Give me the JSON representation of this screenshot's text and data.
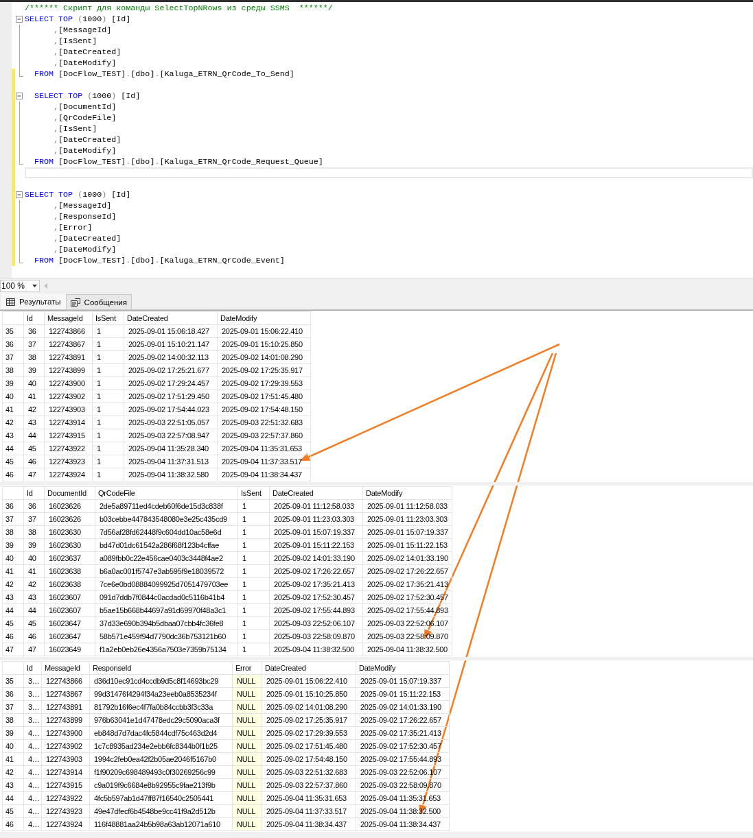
{
  "editor": {
    "lines": [
      {
        "changed": false,
        "kind": "plain",
        "current": false,
        "segments": [
          {
            "kind": "comment",
            "text": "/****** Скрипт для команды SelectTopNRows из среды SSMS  ******/"
          }
        ]
      },
      {
        "changed": false,
        "kind": "fold-start",
        "current": false,
        "segments": [
          {
            "kind": "keyword",
            "text": "SELECT TOP "
          },
          {
            "kind": "punct",
            "text": "("
          },
          {
            "kind": "plain",
            "text": "1000"
          },
          {
            "kind": "punct",
            "text": ")"
          },
          {
            "kind": "plain",
            "text": " [Id]"
          }
        ]
      },
      {
        "changed": false,
        "kind": "fold-inner",
        "current": false,
        "segments": [
          {
            "kind": "punct",
            "text": "      ,"
          },
          {
            "kind": "plain",
            "text": "[MessageId]"
          }
        ]
      },
      {
        "changed": false,
        "kind": "fold-inner",
        "current": false,
        "segments": [
          {
            "kind": "punct",
            "text": "      ,"
          },
          {
            "kind": "plain",
            "text": "[IsSent]"
          }
        ]
      },
      {
        "changed": false,
        "kind": "fold-inner",
        "current": false,
        "segments": [
          {
            "kind": "punct",
            "text": "      ,"
          },
          {
            "kind": "plain",
            "text": "[DateCreated]"
          }
        ]
      },
      {
        "changed": false,
        "kind": "fold-inner",
        "current": false,
        "segments": [
          {
            "kind": "punct",
            "text": "      ,"
          },
          {
            "kind": "plain",
            "text": "[DateModify]"
          }
        ]
      },
      {
        "changed": true,
        "kind": "fold-end",
        "current": false,
        "segments": [
          {
            "kind": "keyword",
            "text": "  FROM"
          },
          {
            "kind": "plain",
            "text": " [DocFlow_TEST]"
          },
          {
            "kind": "punct",
            "text": "."
          },
          {
            "kind": "plain",
            "text": "[dbo]"
          },
          {
            "kind": "punct",
            "text": "."
          },
          {
            "kind": "plain",
            "text": "[Kaluga_ETRN_QrCode_To_Send]"
          }
        ]
      },
      {
        "changed": true,
        "kind": "plain",
        "current": false
      },
      {
        "changed": true,
        "kind": "fold-start",
        "current": false,
        "segments": [
          {
            "kind": "keyword",
            "text": "  SELECT TOP "
          },
          {
            "kind": "punct",
            "text": "("
          },
          {
            "kind": "plain",
            "text": "1000"
          },
          {
            "kind": "punct",
            "text": ")"
          },
          {
            "kind": "plain",
            "text": " [Id]"
          }
        ]
      },
      {
        "changed": true,
        "kind": "fold-inner",
        "current": false,
        "segments": [
          {
            "kind": "punct",
            "text": "      ,"
          },
          {
            "kind": "plain",
            "text": "[DocumentId]"
          }
        ]
      },
      {
        "changed": true,
        "kind": "fold-inner",
        "current": false,
        "segments": [
          {
            "kind": "punct",
            "text": "      ,"
          },
          {
            "kind": "plain",
            "text": "[QrCodeFile]"
          }
        ]
      },
      {
        "changed": true,
        "kind": "fold-inner",
        "current": false,
        "segments": [
          {
            "kind": "punct",
            "text": "      ,"
          },
          {
            "kind": "plain",
            "text": "[IsSent]"
          }
        ]
      },
      {
        "changed": true,
        "kind": "fold-inner",
        "current": false,
        "segments": [
          {
            "kind": "punct",
            "text": "      ,"
          },
          {
            "kind": "plain",
            "text": "[DateCreated]"
          }
        ]
      },
      {
        "changed": true,
        "kind": "fold-inner",
        "current": false,
        "segments": [
          {
            "kind": "punct",
            "text": "      ,"
          },
          {
            "kind": "plain",
            "text": "[DateModify]"
          }
        ]
      },
      {
        "changed": true,
        "kind": "fold-end",
        "current": false,
        "segments": [
          {
            "kind": "keyword",
            "text": "  FROM"
          },
          {
            "kind": "plain",
            "text": " [DocFlow_TEST]"
          },
          {
            "kind": "punct",
            "text": "."
          },
          {
            "kind": "plain",
            "text": "[dbo]"
          },
          {
            "kind": "punct",
            "text": "."
          },
          {
            "kind": "plain",
            "text": "[Kaluga_ETRN_QrCode_Request_Queue]"
          }
        ]
      },
      {
        "changed": true,
        "kind": "plain",
        "current": true
      },
      {
        "changed": true,
        "kind": "plain",
        "current": false
      },
      {
        "changed": true,
        "kind": "fold-start",
        "current": false,
        "segments": [
          {
            "kind": "keyword",
            "text": "SELECT TOP "
          },
          {
            "kind": "punct",
            "text": "("
          },
          {
            "kind": "plain",
            "text": "1000"
          },
          {
            "kind": "punct",
            "text": ")"
          },
          {
            "kind": "plain",
            "text": " [Id]"
          }
        ]
      },
      {
        "changed": true,
        "kind": "fold-inner",
        "current": false,
        "segments": [
          {
            "kind": "punct",
            "text": "      ,"
          },
          {
            "kind": "plain",
            "text": "[MessageId]"
          }
        ]
      },
      {
        "changed": true,
        "kind": "fold-inner",
        "current": false,
        "segments": [
          {
            "kind": "punct",
            "text": "      ,"
          },
          {
            "kind": "plain",
            "text": "[ResponseId]"
          }
        ]
      },
      {
        "changed": true,
        "kind": "fold-inner",
        "current": false,
        "segments": [
          {
            "kind": "punct",
            "text": "      ,"
          },
          {
            "kind": "plain",
            "text": "[Error]"
          }
        ]
      },
      {
        "changed": true,
        "kind": "fold-inner",
        "current": false,
        "segments": [
          {
            "kind": "punct",
            "text": "      ,"
          },
          {
            "kind": "plain",
            "text": "[DateCreated]"
          }
        ]
      },
      {
        "changed": true,
        "kind": "fold-inner",
        "current": false,
        "segments": [
          {
            "kind": "punct",
            "text": "      ,"
          },
          {
            "kind": "plain",
            "text": "[DateModify]"
          }
        ]
      },
      {
        "changed": true,
        "kind": "fold-end",
        "current": false,
        "segments": [
          {
            "kind": "keyword",
            "text": "  FROM"
          },
          {
            "kind": "plain",
            "text": " [DocFlow_TEST]"
          },
          {
            "kind": "punct",
            "text": "."
          },
          {
            "kind": "plain",
            "text": "[dbo]"
          },
          {
            "kind": "punct",
            "text": "."
          },
          {
            "kind": "plain",
            "text": "[Kaluga_ETRN_QrCode_Event]"
          }
        ]
      }
    ]
  },
  "zoom": {
    "value": "100 %"
  },
  "tabs": [
    {
      "label": "Результаты",
      "kind": "grid",
      "selected": true
    },
    {
      "label": "Сообщения",
      "kind": "messages",
      "selected": false
    }
  ],
  "grids": [
    {
      "columns": [
        {
          "name": "Id",
          "kind": "text"
        },
        {
          "name": "MessageId",
          "kind": "text"
        },
        {
          "name": "IsSent",
          "kind": "text"
        },
        {
          "name": "DateCreated",
          "kind": "text"
        },
        {
          "name": "DateModify",
          "kind": "text"
        }
      ],
      "rows": [
        {
          "number": "35",
          "cells": [
            "36",
            "122743866",
            "1",
            "2025-09-01 15:06:18.427",
            "2025-09-01 15:06:22.410"
          ]
        },
        {
          "number": "36",
          "cells": [
            "37",
            "122743867",
            "1",
            "2025-09-01 15:10:21.147",
            "2025-09-01 15:10:25.850"
          ]
        },
        {
          "number": "37",
          "cells": [
            "38",
            "122743891",
            "1",
            "2025-09-02 14:00:32.113",
            "2025-09-02 14:01:08.290"
          ]
        },
        {
          "number": "38",
          "cells": [
            "39",
            "122743899",
            "1",
            "2025-09-02 17:25:21.677",
            "2025-09-02 17:25:35.917"
          ]
        },
        {
          "number": "39",
          "cells": [
            "40",
            "122743900",
            "1",
            "2025-09-02 17:29:24.457",
            "2025-09-02 17:29:39.553"
          ]
        },
        {
          "number": "40",
          "cells": [
            "41",
            "122743902",
            "1",
            "2025-09-02 17:51:29.450",
            "2025-09-02 17:51:45.480"
          ]
        },
        {
          "number": "41",
          "cells": [
            "42",
            "122743903",
            "1",
            "2025-09-02 17:54:44.023",
            "2025-09-02 17:54:48.150"
          ]
        },
        {
          "number": "42",
          "cells": [
            "43",
            "122743914",
            "1",
            "2025-09-03 22:51:05.057",
            "2025-09-03 22:51:32.683"
          ]
        },
        {
          "number": "43",
          "cells": [
            "44",
            "122743915",
            "1",
            "2025-09-03 22:57:08.947",
            "2025-09-03 22:57:37.860"
          ]
        },
        {
          "number": "44",
          "cells": [
            "45",
            "122743922",
            "1",
            "2025-09-04 11:35:28.340",
            "2025-09-04 11:35:31.653"
          ]
        },
        {
          "number": "45",
          "cells": [
            "46",
            "122743923",
            "1",
            "2025-09-04 11:37:31.513",
            "2025-09-04 11:37:33.517"
          ]
        },
        {
          "number": "46",
          "cells": [
            "47",
            "122743924",
            "1",
            "2025-09-04 11:38:32.580",
            "2025-09-04 11:38:34.437"
          ]
        }
      ]
    },
    {
      "columns": [
        {
          "name": "Id",
          "kind": "text"
        },
        {
          "name": "DocumentId",
          "kind": "text"
        },
        {
          "name": "QrCodeFile",
          "kind": "text"
        },
        {
          "name": "IsSent",
          "kind": "text"
        },
        {
          "name": "DateCreated",
          "kind": "text"
        },
        {
          "name": "DateModify",
          "kind": "text"
        }
      ],
      "rows": [
        {
          "number": "36",
          "cells": [
            "36",
            "16023626",
            "2de5a89711ed4cdeb60f6de15d3c838f",
            "1",
            "2025-09-01 11:12:58.033",
            "2025-09-01 11:12:58.033"
          ]
        },
        {
          "number": "37",
          "cells": [
            "37",
            "16023626",
            "b03cebbe447843548080e3e25c435cd9",
            "1",
            "2025-09-01 11:23:03.303",
            "2025-09-01 11:23:03.303"
          ]
        },
        {
          "number": "38",
          "cells": [
            "38",
            "16023630",
            "7d56af28fd62448f9c604dd10ac58e6d",
            "1",
            "2025-09-01 15:07:19.337",
            "2025-09-01 15:07:19.337"
          ]
        },
        {
          "number": "39",
          "cells": [
            "39",
            "16023630",
            "bd47d01dc61542a286f68f123b4cffae",
            "1",
            "2025-09-01 15:11:22.153",
            "2025-09-01 15:11:22.153"
          ]
        },
        {
          "number": "40",
          "cells": [
            "40",
            "16023637",
            "a089fbb0c22e456cae0403c3448f4ae2",
            "1",
            "2025-09-02 14:01:33.190",
            "2025-09-02 14:01:33.190"
          ]
        },
        {
          "number": "41",
          "cells": [
            "41",
            "16023638",
            "b6a0ac001f5747e3ab595f9e18039572",
            "1",
            "2025-09-02 17:26:22.657",
            "2025-09-02 17:26:22.657"
          ]
        },
        {
          "number": "42",
          "cells": [
            "42",
            "16023638",
            "7ce6e0bd08884099925d7051479703ee",
            "1",
            "2025-09-02 17:35:21.413",
            "2025-09-02 17:35:21.413"
          ]
        },
        {
          "number": "43",
          "cells": [
            "43",
            "16023607",
            "091d7ddb7f0844c0acdad0c5116b41b4",
            "1",
            "2025-09-02 17:52:30.457",
            "2025-09-02 17:52:30.457"
          ]
        },
        {
          "number": "44",
          "cells": [
            "44",
            "16023607",
            "b5ae15b668b44697a91d69970f48a3c1",
            "1",
            "2025-09-02 17:55:44.893",
            "2025-09-02 17:55:44.893"
          ]
        },
        {
          "number": "45",
          "cells": [
            "45",
            "16023647",
            "37d33e690b394b5dbaa07cbb4fc36fe8",
            "1",
            "2025-09-03 22:52:06.107",
            "2025-09-03 22:52:06.107"
          ]
        },
        {
          "number": "46",
          "cells": [
            "46",
            "16023647",
            "58b571e459f94d7790dc36b753121b60",
            "1",
            "2025-09-03 22:58:09.870",
            "2025-09-03 22:58:09.870"
          ]
        },
        {
          "number": "47",
          "cells": [
            "47",
            "16023649",
            "f1a2eb0eb26e4356a7503e7359b75134",
            "1",
            "2025-09-04 11:38:32.500",
            "2025-09-04 11:38:32.500"
          ]
        }
      ]
    },
    {
      "columns": [
        {
          "name": "Id",
          "kind": "text"
        },
        {
          "name": "MessageId",
          "kind": "text"
        },
        {
          "name": "ResponseId",
          "kind": "text"
        },
        {
          "name": "Error",
          "kind": "null"
        },
        {
          "name": "DateCreated",
          "kind": "text"
        },
        {
          "name": "DateModify",
          "kind": "text"
        }
      ],
      "rows": [
        {
          "number": "35",
          "cells": [
            "3…",
            "122743866",
            "d36d10ec91cd4ccdb9d5c8f14693bc29",
            "NULL",
            "2025-09-01 15:06:22.410",
            "2025-09-01 15:07:19.337"
          ]
        },
        {
          "number": "36",
          "cells": [
            "3…",
            "122743867",
            "99d31476f4294f34a23eeb0a8535234f",
            "NULL",
            "2025-09-01 15:10:25.850",
            "2025-09-01 15:11:22.153"
          ]
        },
        {
          "number": "37",
          "cells": [
            "3…",
            "122743891",
            "81792b16f6ec4f7fa0b84ccbb3f3c33a",
            "NULL",
            "2025-09-02 14:01:08.290",
            "2025-09-02 14:01:33.190"
          ]
        },
        {
          "number": "38",
          "cells": [
            "3…",
            "122743899",
            "976b63041e1d47478edc29c5090aca3f",
            "NULL",
            "2025-09-02 17:25:35.917",
            "2025-09-02 17:26:22.657"
          ]
        },
        {
          "number": "39",
          "cells": [
            "4…",
            "122743900",
            "eb848d7d7dac4fc5844cdf75c463d2d4",
            "NULL",
            "2025-09-02 17:29:39.553",
            "2025-09-02 17:35:21.413"
          ]
        },
        {
          "number": "40",
          "cells": [
            "4…",
            "122743902",
            "1c7c8935ad234e2ebb6fc8344b0f1b25",
            "NULL",
            "2025-09-02 17:51:45.480",
            "2025-09-02 17:52:30.457"
          ]
        },
        {
          "number": "41",
          "cells": [
            "4…",
            "122743903",
            "1994c2feb0ea42f2b05ae2046f5167b0",
            "NULL",
            "2025-09-02 17:54:48.150",
            "2025-09-02 17:55:44.893"
          ]
        },
        {
          "number": "42",
          "cells": [
            "4…",
            "122743914",
            "f1f90209c698489493c0f30269256c99",
            "NULL",
            "2025-09-03 22:51:32.683",
            "2025-09-03 22:52:06.107"
          ]
        },
        {
          "number": "43",
          "cells": [
            "4…",
            "122743915",
            "c9a019f9c6684e8b92955c9fae213f9b",
            "NULL",
            "2025-09-03 22:57:37.860",
            "2025-09-03 22:58:09.870"
          ]
        },
        {
          "number": "44",
          "cells": [
            "4…",
            "122743922",
            "4fc5b597ab1d47ff87f16540c2505441",
            "NULL",
            "2025-09-04 11:35:31.653",
            "2025-09-04 11:35:31.653"
          ]
        },
        {
          "number": "45",
          "cells": [
            "4…",
            "122743923",
            "49e47dfecf6b4548be9cc41f9a2d512b",
            "NULL",
            "2025-09-04 11:37:33.517",
            "2025-09-04 11:38:32.500"
          ]
        },
        {
          "number": "46",
          "cells": [
            "4…",
            "122743924",
            "116f48881aa24b5b98a63ab12071a610",
            "NULL",
            "2025-09-04 11:38:34.437",
            "2025-09-04 11:38:34.437"
          ]
        }
      ]
    }
  ]
}
